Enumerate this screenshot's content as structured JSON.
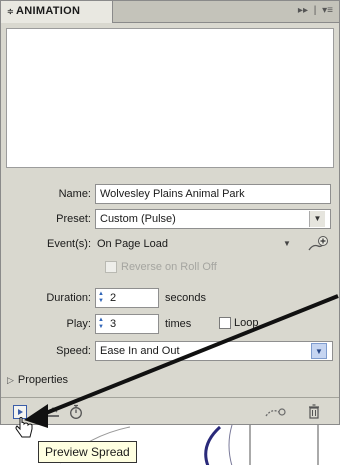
{
  "panel": {
    "tab_label": "ANIMATION",
    "tab_prefix": "≑",
    "collapse_glyph": "▸▸",
    "separator": "|",
    "menu_glyph": "▾≡"
  },
  "form": {
    "name_label": "Name:",
    "name_value": "Wolvesley Plains Animal Park",
    "preset_label": "Preset:",
    "preset_value": "Custom (Pulse)",
    "events_label": "Event(s):",
    "events_value": "On Page Load",
    "reverse_label": "Reverse on Roll Off",
    "duration_label": "Duration:",
    "duration_value": "2",
    "duration_unit": "seconds",
    "play_label": "Play:",
    "play_value": "3",
    "play_unit": "times",
    "loop_label": "Loop",
    "speed_label": "Speed:",
    "speed_value": "Ease In and Out"
  },
  "properties": {
    "label": "Properties"
  },
  "tooltip": {
    "text": "Preview Spread"
  },
  "icons": [
    "chevron-down-icon",
    "event-add-icon",
    "play-preview-icon",
    "preview-spread-icon",
    "timing-icon",
    "path-icon",
    "trash-icon"
  ],
  "colors": {
    "panel_bg": "#d9d8cf",
    "tab_bg": "#e9e8e1",
    "field_bg": "#ffffff",
    "tooltip_bg": "#ffffe1",
    "arrow": "#111111"
  }
}
